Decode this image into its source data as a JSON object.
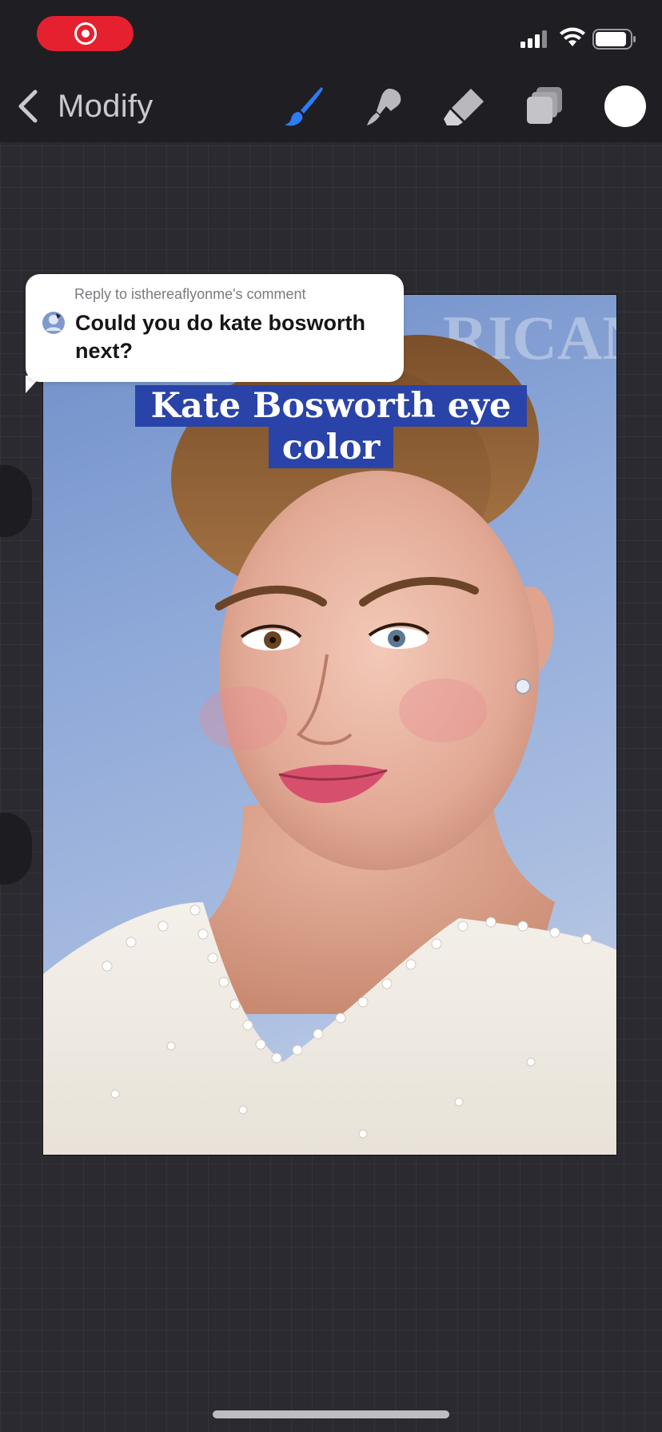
{
  "toolbar": {
    "back_label": "Modify",
    "tools": [
      "brush-icon",
      "smudge-icon",
      "eraser-icon",
      "layers-icon"
    ],
    "active_tool": "brush-icon",
    "active_tool_color": "#2d7cf6",
    "current_color": "#ffffff"
  },
  "status_bar": {
    "recording_color": "#e5202f"
  },
  "reply": {
    "header": "Reply to isthereaflyonme's comment",
    "body": "Could you do kate bosworth next?"
  },
  "caption": {
    "line1": "Kate Bosworth eye",
    "line2": "color",
    "background_color": "#2a43a8"
  }
}
